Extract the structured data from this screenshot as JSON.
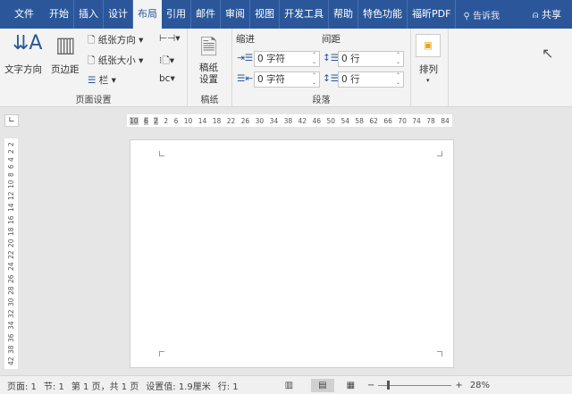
{
  "tabs": [
    "文件",
    "开始",
    "插入",
    "设计",
    "布局",
    "引用",
    "邮件",
    "审阅",
    "视图",
    "开发工具",
    "帮助",
    "特色功能",
    "福昕PDF"
  ],
  "active_tab": "布局",
  "tell_me": "告诉我",
  "share": "共享",
  "ribbon": {
    "page_setup": {
      "text_direction": "文字方向",
      "margins": "页边距",
      "orientation": "纸张方向",
      "size": "纸张大小",
      "columns": "栏",
      "label": "页面设置"
    },
    "manuscript": {
      "button": "稿纸设置",
      "label": "稿纸"
    },
    "paragraph": {
      "indent": "缩进",
      "spacing": "间距",
      "indent_left": "0 字符",
      "indent_right": "0 字符",
      "spacing_before": "0 行",
      "spacing_after": "0 行",
      "label": "段落"
    },
    "arrange": {
      "label": "排列"
    }
  },
  "ruler_h": [
    "10",
    "6",
    "2",
    "2",
    "6",
    "10",
    "14",
    "18",
    "22",
    "26",
    "30",
    "34",
    "38",
    "42",
    "46",
    "50",
    "54",
    "58",
    "62",
    "66",
    "70",
    "74",
    "78",
    "84"
  ],
  "ruler_v": [
    "2",
    "2",
    "4",
    "6",
    "8",
    "10",
    "12",
    "14",
    "16",
    "18",
    "20",
    "22",
    "24",
    "26",
    "28",
    "30",
    "32",
    "34",
    "36",
    "38",
    "42"
  ],
  "status": {
    "page": "页面: 1",
    "section": "节: 1",
    "page_count": "第 1 页，共 1 页",
    "setting": "设置值: 1.9厘米",
    "line": "行: 1",
    "zoom": "28%"
  },
  "colors": {
    "accent": "#2b579a"
  }
}
